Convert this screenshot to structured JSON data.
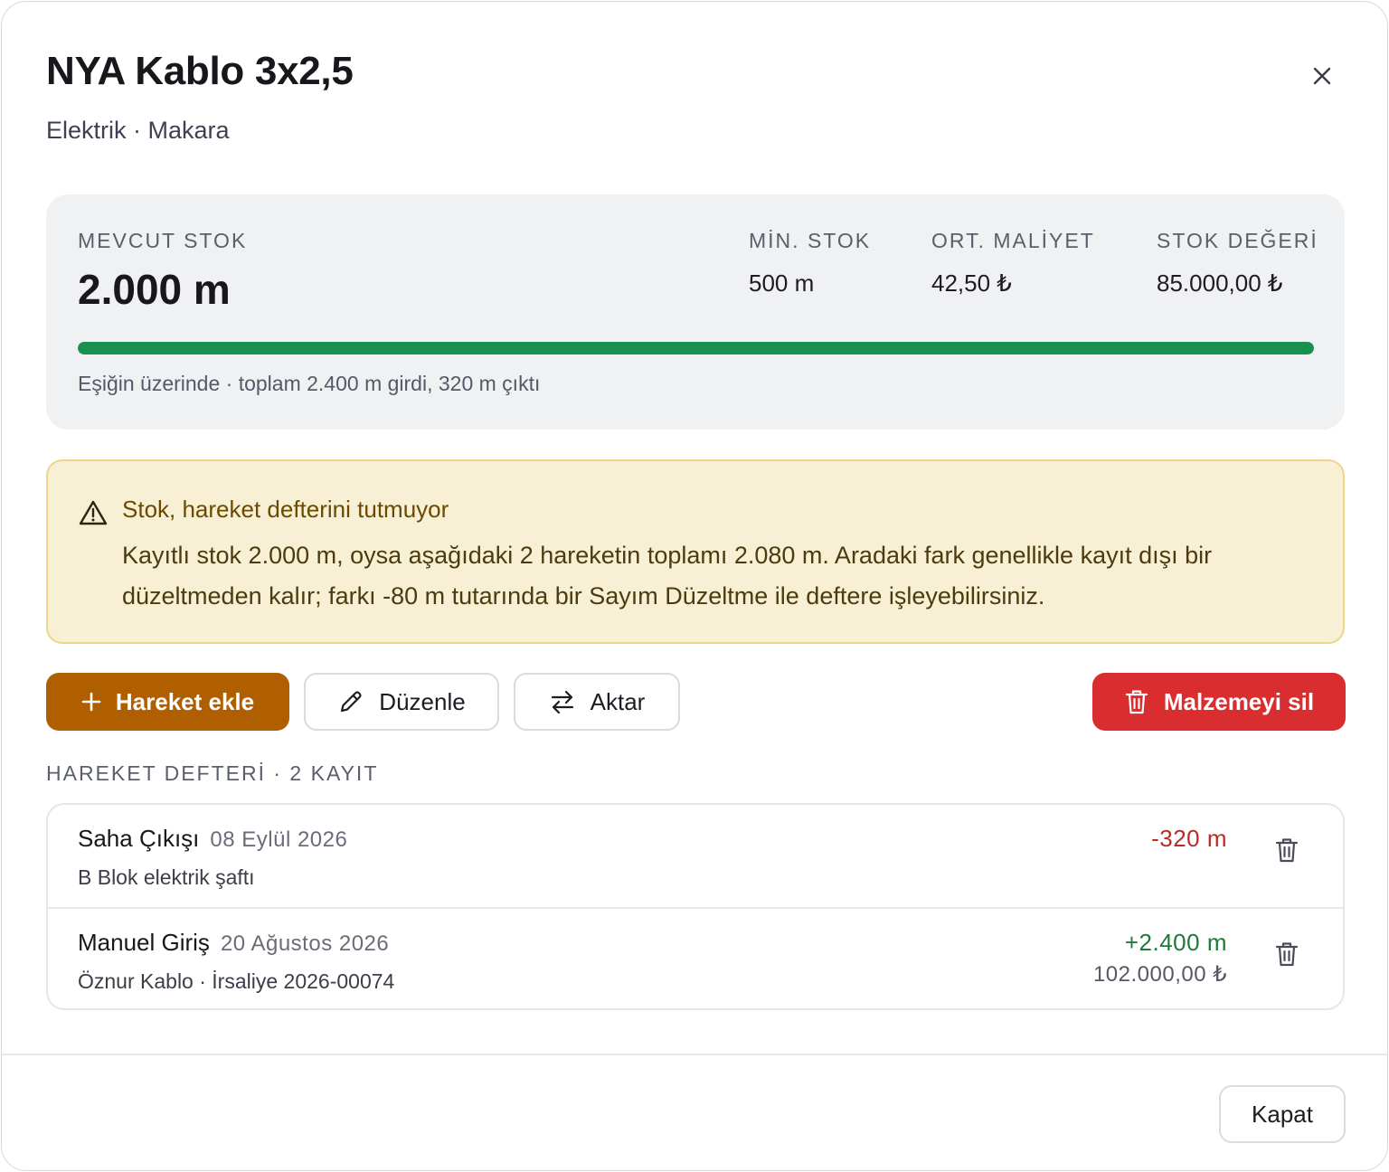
{
  "dialog": {
    "title": "NYA Kablo 3x2,5",
    "subtitle": "Elektrik · Makara",
    "close_icon": "close-icon"
  },
  "stats": {
    "current_label": "MEVCUT STOK",
    "current_value": "2.000 m",
    "min_label": "MİN. STOK",
    "min_value": "500 m",
    "avg_cost_label": "ORT. MALİYET",
    "avg_cost_value": "42,50 ₺",
    "stock_value_label": "STOK DEĞERİ",
    "stock_value_value": "85.000,00 ₺",
    "progress_fraction": 1.0,
    "progress_color": "#17914d",
    "note": "Eşiğin üzerinde · toplam 2.400 m girdi, 320 m çıktı"
  },
  "warning": {
    "icon": "warning-triangle-icon",
    "title": "Stok, hareket defterini tutmuyor",
    "body": "Kayıtlı stok 2.000 m, oysa aşağıdaki 2 hareketin toplamı 2.080 m. Aradaki fark genellikle kayıt dışı bir düzeltmeden kalır; farkı -80 m tutarında bir Sayım Düzeltme ile deftere işleyebilirsiniz."
  },
  "actions": {
    "add_label": "Hareket ekle",
    "edit_label": "Düzenle",
    "transfer_label": "Aktar",
    "delete_label": "Malzemeyi sil"
  },
  "ledger": {
    "heading": "HAREKET DEFTERİ · 2 KAYIT",
    "rows": [
      {
        "type": "Saha Çıkışı",
        "date": "08 Eylül 2026",
        "description": "B Blok elektrik şaftı",
        "amount": "-320 m",
        "cost": ""
      },
      {
        "type": "Manuel Giriş",
        "date": "20 Ağustos 2026",
        "description": "Öznur Kablo · İrsaliye 2026-00074",
        "amount": "+2.400 m",
        "cost": "102.000,00 ₺"
      }
    ]
  },
  "footer": {
    "close_label": "Kapat"
  },
  "colors": {
    "primary": "#b05f00",
    "danger": "#d92d30",
    "positive": "#1d7a3a",
    "negative": "#bb2a26",
    "warning_bg": "#f8f0d4"
  }
}
